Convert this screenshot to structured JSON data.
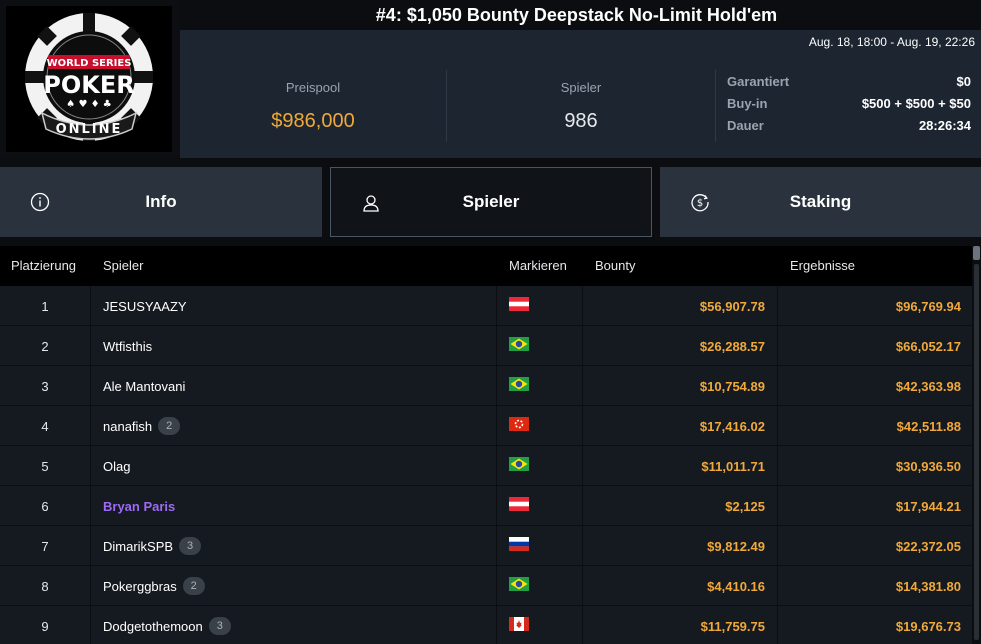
{
  "header": {
    "title": "#4: $1,050 Bounty Deepstack No-Limit Hold'em",
    "dates": "Aug. 18, 18:00 - Aug. 19, 22:26",
    "logo": {
      "top": "WORLD SERIES",
      "middle": "POKER",
      "bottom": "ONLINE"
    }
  },
  "stats": {
    "prize_pool_label": "Preispool",
    "prize_pool_value": "$986,000",
    "players_label": "Spieler",
    "players_value": "986",
    "guaranteed_label": "Garantiert",
    "guaranteed_value": "$0",
    "buyin_label": "Buy-in",
    "buyin_value": "$500 + $500 + $50",
    "duration_label": "Dauer",
    "duration_value": "28:26:34"
  },
  "tabs": [
    {
      "label": "Info",
      "icon": "info-icon"
    },
    {
      "label": "Spieler",
      "icon": "user-icon"
    },
    {
      "label": "Staking",
      "icon": "dollar-coin-icon"
    }
  ],
  "table": {
    "headers": {
      "rank": "Platzierung",
      "player": "Spieler",
      "flag": "Markieren",
      "bounty": "Bounty",
      "result": "Ergebnisse"
    },
    "rows": [
      {
        "rank": "1",
        "name": "JESUSYAAZY",
        "badge": "",
        "flag": "austria",
        "bounty": "$56,907.78",
        "result": "$96,769.94",
        "highlight": false
      },
      {
        "rank": "2",
        "name": "Wtfisthis",
        "badge": "",
        "flag": "brazil",
        "bounty": "$26,288.57",
        "result": "$66,052.17",
        "highlight": false
      },
      {
        "rank": "3",
        "name": "Ale Mantovani",
        "badge": "",
        "flag": "brazil",
        "bounty": "$10,754.89",
        "result": "$42,363.98",
        "highlight": false
      },
      {
        "rank": "4",
        "name": "nanafish",
        "badge": "2",
        "flag": "hong-kong",
        "bounty": "$17,416.02",
        "result": "$42,511.88",
        "highlight": false
      },
      {
        "rank": "5",
        "name": "Olag",
        "badge": "",
        "flag": "brazil",
        "bounty": "$11,011.71",
        "result": "$30,936.50",
        "highlight": false
      },
      {
        "rank": "6",
        "name": "Bryan Paris",
        "badge": "",
        "flag": "austria",
        "bounty": "$2,125",
        "result": "$17,944.21",
        "highlight": true
      },
      {
        "rank": "7",
        "name": "DimarikSPB",
        "badge": "3",
        "flag": "russia",
        "bounty": "$9,812.49",
        "result": "$22,372.05",
        "highlight": false
      },
      {
        "rank": "8",
        "name": "Pokerggbras",
        "badge": "2",
        "flag": "brazil",
        "bounty": "$4,410.16",
        "result": "$14,381.80",
        "highlight": false
      },
      {
        "rank": "9",
        "name": "Dodgetothemoon",
        "badge": "3",
        "flag": "canada",
        "bounty": "$11,759.75",
        "result": "$19,676.73",
        "highlight": false
      }
    ]
  },
  "colors": {
    "accent": "#f0a93a",
    "highlight_name": "#9b6bf2",
    "panel": "#1c2530",
    "row": "#151a21"
  }
}
